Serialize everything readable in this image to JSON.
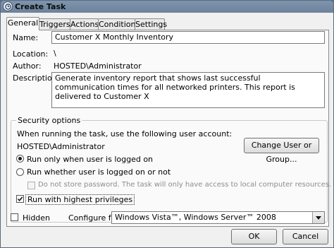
{
  "window": {
    "title": "Create Task"
  },
  "tabs": [
    {
      "label": "General"
    },
    {
      "label": "Triggers"
    },
    {
      "label": "Actions"
    },
    {
      "label": "Conditions"
    },
    {
      "label": "Settings"
    }
  ],
  "general": {
    "name_label": "Name:",
    "name_value": "Customer X Monthly Inventory",
    "location_label": "Location:",
    "location_value": "\\",
    "author_label": "Author:",
    "author_value": "HOSTED\\Administrator",
    "description_label": "Description:",
    "description_value": "Generate inventory report that shows last successful communication times for all networked printers.  This report is delivered to Customer X"
  },
  "security": {
    "legend": "Security options",
    "account_prompt": "When running the task, use the following user account:",
    "account_value": "HOSTED\\Administrator",
    "change_user_button": "Change User or Group...",
    "radio_logged_on": "Run only when user is logged on",
    "radio_logged_on_checked": true,
    "radio_whether": "Run whether user is logged on or not",
    "radio_whether_checked": false,
    "no_store_password": "Do not store password.  The task will only have access to local computer resources.",
    "highest_privileges": "Run with highest privileges",
    "highest_privileges_checked": true
  },
  "footer": {
    "hidden_label": "Hidden",
    "hidden_checked": false,
    "configure_label": "Configure for:",
    "configure_value": "Windows Vista™, Windows Server™ 2008",
    "ok_button": "OK",
    "cancel_button": "Cancel"
  }
}
